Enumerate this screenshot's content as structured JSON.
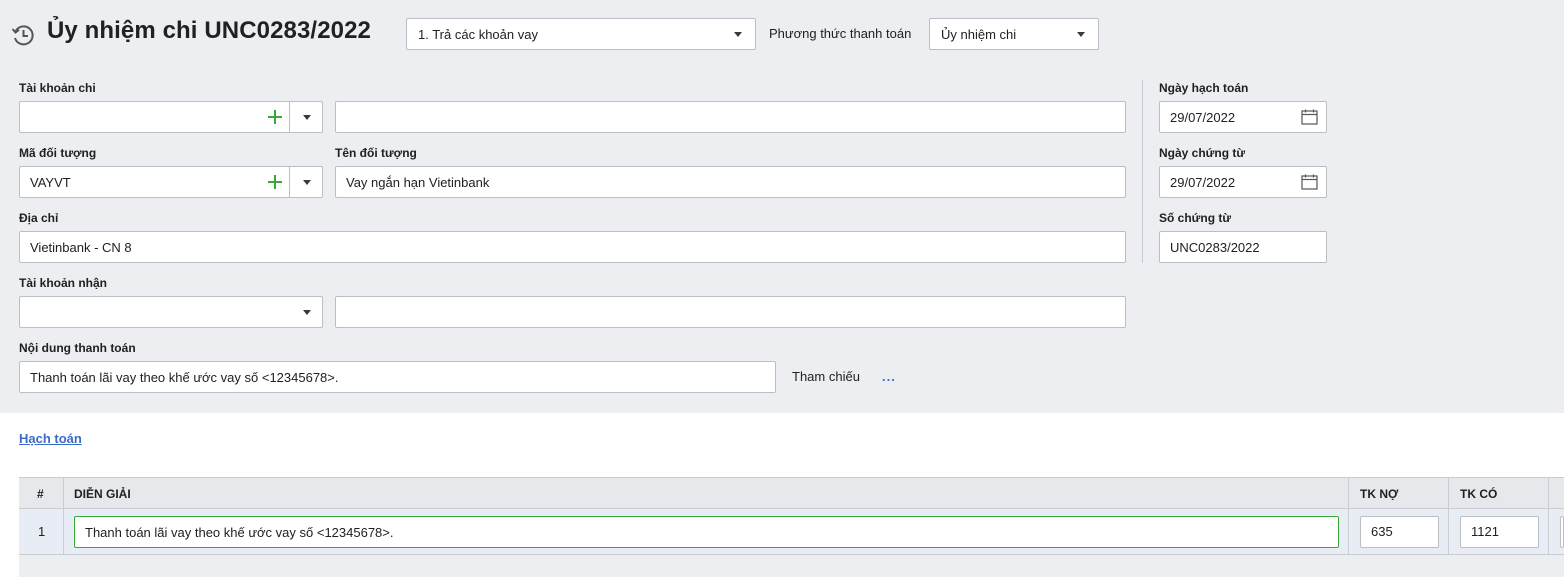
{
  "header": {
    "title": "Ủy nhiệm chi UNC0283/2022",
    "purpose_select": "1. Trả các khoản vay",
    "payment_method_label": "Phương thức thanh toán",
    "payment_method_select": "Ủy nhiệm chi"
  },
  "form": {
    "pay_account": {
      "label": "Tài khoản chi",
      "value": "",
      "bank_name": ""
    },
    "object_code": {
      "label": "Mã đối tượng",
      "value": "VAYVT"
    },
    "object_name": {
      "label": "Tên đối tượng",
      "value": "Vay ngắn hạn Vietinbank"
    },
    "address": {
      "label": "Địa chỉ",
      "value": "Vietinbank - CN 8"
    },
    "receive_account": {
      "label": "Tài khoản nhận",
      "value": "",
      "bank_name": ""
    },
    "payment_content": {
      "label": "Nội dung thanh toán",
      "value": "Thanh toán lãi vay theo khế ước vay số <12345678>."
    },
    "reference": {
      "label": "Tham chiếu",
      "more": "..."
    },
    "posting_date": {
      "label": "Ngày hạch toán",
      "value": "29/07/2022"
    },
    "voucher_date": {
      "label": "Ngày chứng từ",
      "value": "29/07/2022"
    },
    "voucher_no": {
      "label": "Số chứng từ",
      "value": "UNC0283/2022"
    }
  },
  "accounting": {
    "tab_label": "Hạch toán",
    "columns": [
      "#",
      "DIỄN GIẢI",
      "TK NỢ",
      "TK CÓ"
    ],
    "rows": [
      {
        "num": "1",
        "description": "Thanh toán lãi vay theo khế ước vay số <12345678>.",
        "debit": "635",
        "credit": "1121"
      }
    ]
  },
  "colors": {
    "background": "#eceef1",
    "accent_green": "#39a83a",
    "link_blue": "#3a6cc7"
  },
  "icons": [
    "history-icon",
    "chevron-down-icon",
    "plus-icon",
    "calendar-icon"
  ]
}
